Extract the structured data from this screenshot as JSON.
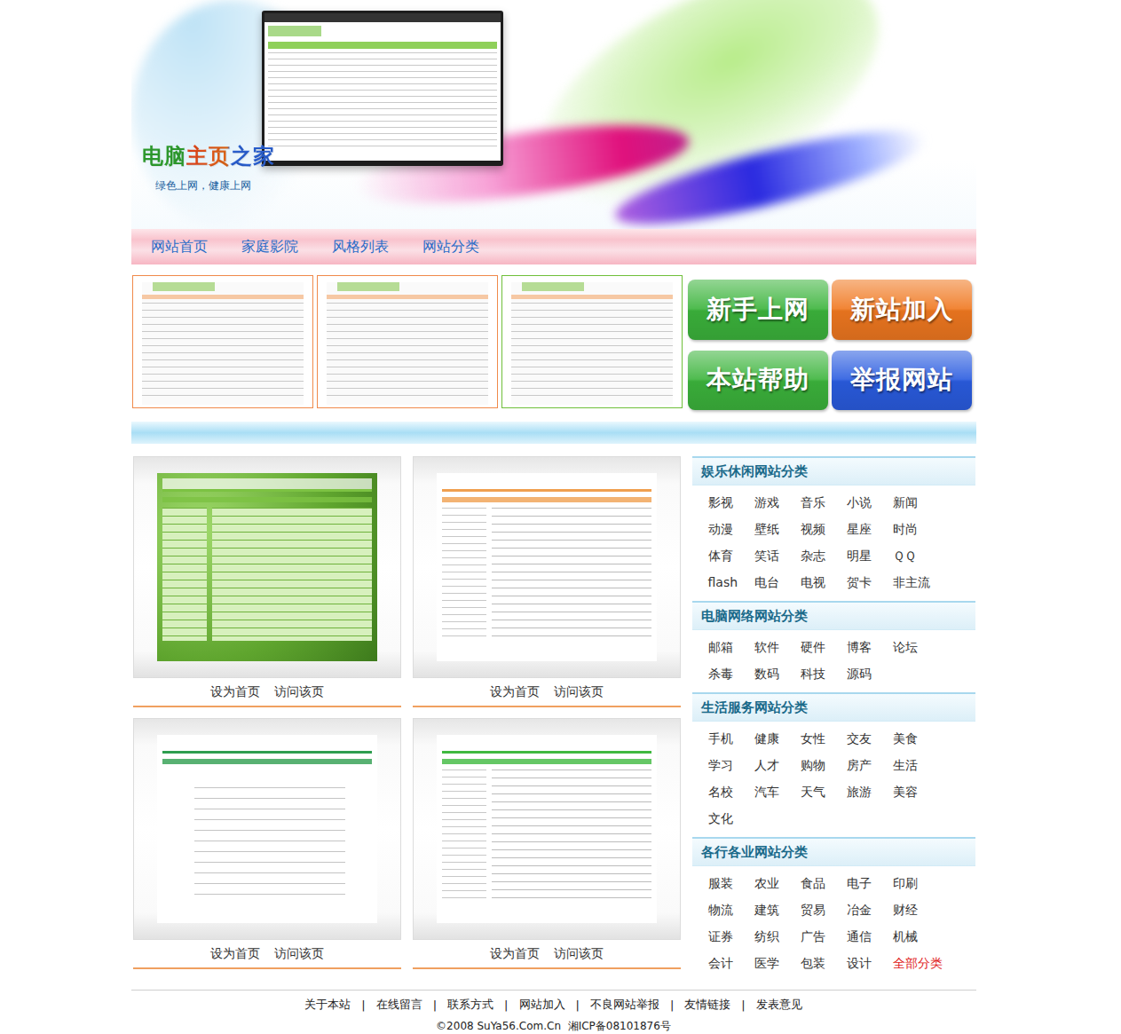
{
  "logo": {
    "title": "电脑主页之家",
    "slogan": "绿色上网，健康上网"
  },
  "nav": [
    "网站首页",
    "家庭影院",
    "风格列表",
    "网站分类"
  ],
  "previews": [
    {
      "color": "#f08a4b"
    },
    {
      "color": "#f08a4b"
    },
    {
      "color": "#6fbf3a"
    }
  ],
  "quick_buttons": [
    {
      "label": "新手上网",
      "color": "#3cb43c"
    },
    {
      "label": "新站加入",
      "color": "#f07820"
    },
    {
      "label": "本站帮助",
      "color": "#3cb43c"
    },
    {
      "label": "举报网站",
      "color": "#2a5ce0"
    }
  ],
  "styles": [
    {
      "kind": "leaf",
      "color": "#7cc242",
      "actions": [
        "设为首页",
        "访问该页"
      ]
    },
    {
      "kind": "plain",
      "color": "#f0a050",
      "actions": [
        "设为首页",
        "访问该页"
      ]
    },
    {
      "kind": "simple",
      "color": "#2e9e4f",
      "actions": [
        "设为首页",
        "访问该页"
      ]
    },
    {
      "kind": "plain",
      "color": "#3fb93f",
      "actions": [
        "设为首页",
        "访问该页"
      ]
    }
  ],
  "categories": [
    {
      "title": "娱乐休闲网站分类",
      "items": [
        "影视",
        "游戏",
        "音乐",
        "小说",
        "新闻",
        "动漫",
        "壁纸",
        "视频",
        "星座",
        "时尚",
        "体育",
        "笑话",
        "杂志",
        "明星",
        "ＱＱ",
        "flash",
        "电台",
        "电视",
        "贺卡",
        "非主流"
      ]
    },
    {
      "title": "电脑网络网站分类",
      "items": [
        "邮箱",
        "软件",
        "硬件",
        "博客",
        "论坛",
        "杀毒",
        "数码",
        "科技",
        "源码"
      ]
    },
    {
      "title": "生活服务网站分类",
      "items": [
        "手机",
        "健康",
        "女性",
        "交友",
        "美食",
        "学习",
        "人才",
        "购物",
        "房产",
        "生活",
        "名校",
        "汽车",
        "天气",
        "旅游",
        "美容",
        "文化"
      ]
    },
    {
      "title": "各行各业网站分类",
      "items": [
        "服装",
        "农业",
        "食品",
        "电子",
        "印刷",
        "物流",
        "建筑",
        "贸易",
        "冶金",
        "财经",
        "证券",
        "纺织",
        "广告",
        "通信",
        "机械",
        "会计",
        "医学",
        "包装",
        "设计"
      ]
    }
  ],
  "all_categories": "全部分类",
  "footer": {
    "links": [
      "关于本站",
      "在线留言",
      "联系方式",
      "网站加入",
      "不良网站举报",
      "友情链接",
      "发表意见"
    ],
    "separator": "|",
    "copyright": "©2008 SuYa56.Com.Cn  湘ICP备08101876号"
  }
}
